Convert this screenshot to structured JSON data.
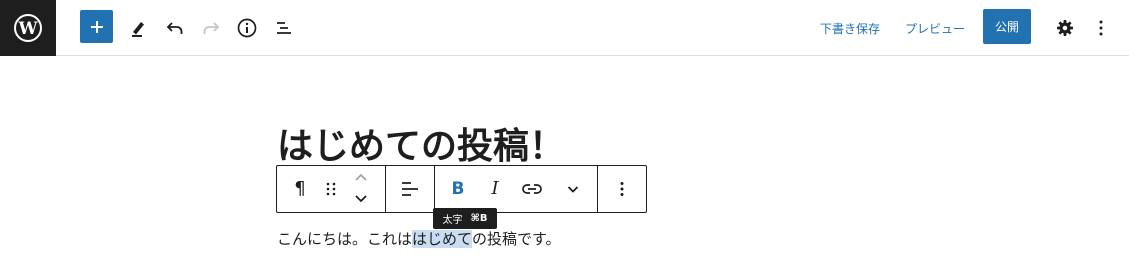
{
  "header": {
    "logo_icon": "wordpress-logo-icon",
    "tools": [
      {
        "name": "add-block-button",
        "icon": "plus-icon"
      },
      {
        "name": "tools-button",
        "icon": "pencil-icon"
      },
      {
        "name": "undo-button",
        "icon": "undo-icon"
      },
      {
        "name": "redo-button",
        "icon": "redo-icon"
      },
      {
        "name": "details-button",
        "icon": "info-icon"
      },
      {
        "name": "list-view-button",
        "icon": "list-view-icon"
      }
    ],
    "save_draft": "下書き保存",
    "preview": "プレビュー",
    "publish": "公開",
    "settings_icon": "gear-icon",
    "options_icon": "more-vertical-icon"
  },
  "editor": {
    "title": "はじめての投稿！",
    "paragraph": {
      "before": "こんにちは。これは",
      "selected": "はじめて",
      "after": "の投稿です。"
    }
  },
  "block_toolbar": {
    "tools": [
      "paragraph-icon",
      "drag-handle-icon",
      "move-up-icon",
      "move-down-icon",
      "align-left-icon",
      "bold-icon",
      "italic-icon",
      "link-icon",
      "chevron-down-icon",
      "more-vertical-icon"
    ],
    "bold_glyph": "B",
    "italic_glyph": "I",
    "paragraph_glyph": "¶"
  },
  "tooltip": {
    "label": "太字",
    "shortcut": "⌘B"
  },
  "colors": {
    "accent": "#2271b1",
    "dark": "#1e1e1e",
    "selection": "#c9dcf1"
  }
}
